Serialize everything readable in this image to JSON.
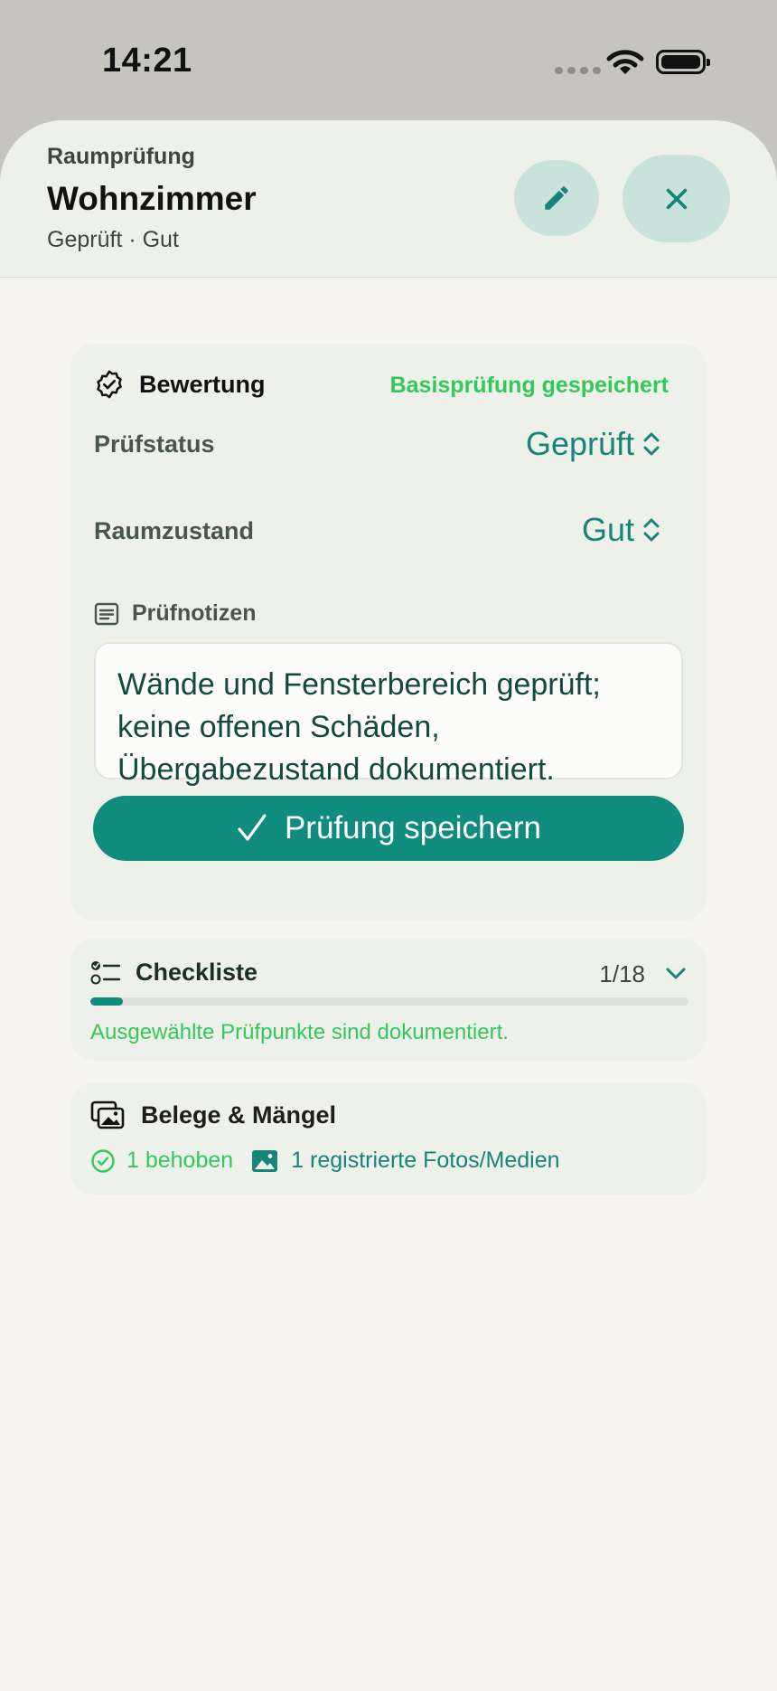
{
  "status_bar": {
    "time": "14:21"
  },
  "header": {
    "eyebrow": "Raumprüfung",
    "title": "Wohnzimmer",
    "subtitle": "Geprüft · Gut",
    "edit_icon": "pencil-icon",
    "close_icon": "close-icon"
  },
  "evaluation": {
    "heading": "Bewertung",
    "saved_note": "Basisprüfung gespeichert",
    "status_label": "Prüfstatus",
    "status_value": "Geprüft",
    "condition_label": "Raumzustand",
    "condition_value": "Gut",
    "notes_label": "Prüfnotizen",
    "notes_text": "Wände und Fensterbereich geprüft; keine offenen Schäden, Übergabezustand dokumentiert.",
    "save_label": "Prüfung speichern"
  },
  "checklist": {
    "title": "Checkliste",
    "count": "1/18",
    "progress_fraction": 0.055,
    "note": "Ausgewählte Prüfpunkte sind dokumentiert."
  },
  "evidence": {
    "title": "Belege & Mängel",
    "fixed": "1 behoben",
    "media": "1 registrierte Fotos/Medien"
  },
  "colors": {
    "accent": "#0f8c7d",
    "success": "#34c759",
    "sheet": "#f5f4ef",
    "card": "#edf1ea"
  }
}
